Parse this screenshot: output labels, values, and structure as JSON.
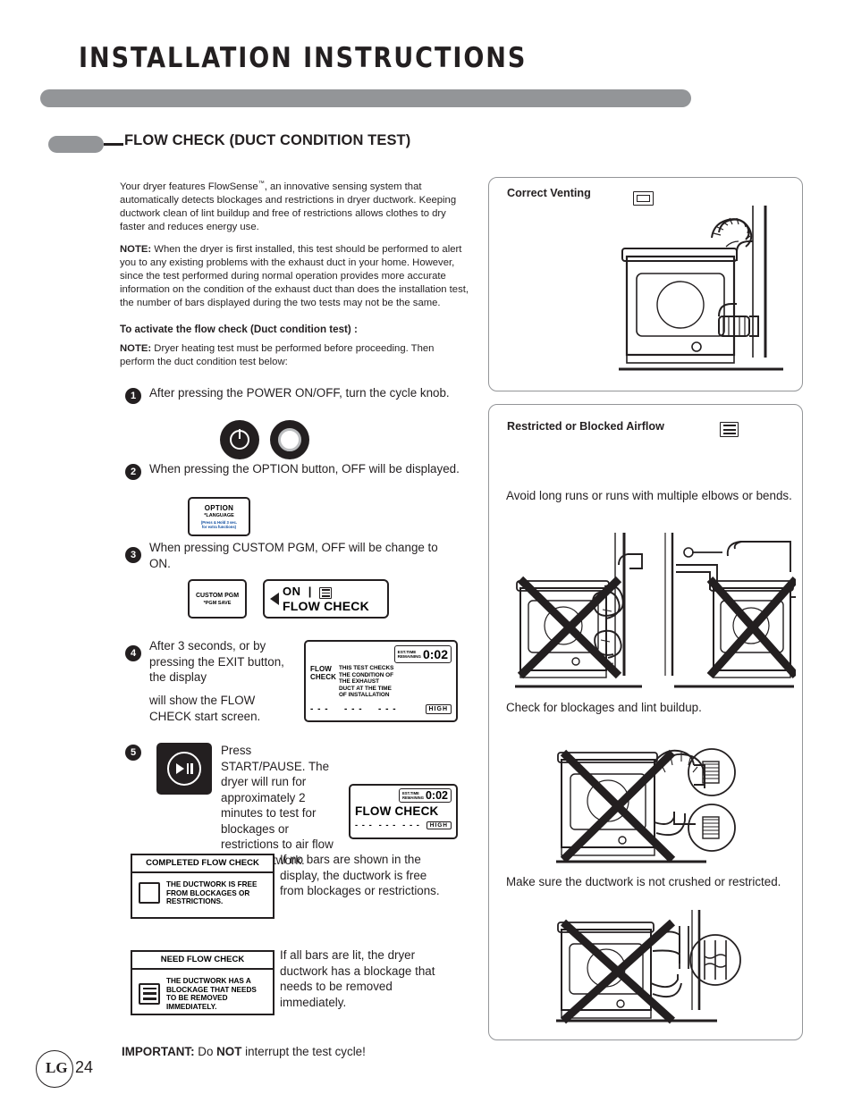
{
  "header": {
    "title": "INSTALLATION INSTRUCTIONS",
    "section_title": "FLOW CHECK (DUCT CONDITION TEST)"
  },
  "intro": {
    "p1_a": "Your dryer features FlowSense",
    "p1_sup": "™",
    "p1_b": ", an innovative sensing system that automatically detects blockages and restrictions in dryer ductwork. Keeping ductwork clean of lint buildup and free of restrictions allows clothes to dry faster and reduces energy use.",
    "note1_label": "NOTE:",
    "note1_text": " When the dryer is first installed, this test should be performed to alert you to any existing problems with the exhaust duct in your home.  However, since the test performed during normal operation provides more accurate information on the condition of the exhaust duct than does the installation test, the number of bars displayed during the two tests may not be the same.",
    "subhead": "To activate the flow check (Duct condition test) :",
    "note2_label": "NOTE:",
    "note2_text": " Dryer heating test must be performed before proceeding. Then perform the duct condition test below:"
  },
  "steps": [
    {
      "num": "1",
      "text": "After pressing the POWER ON/OFF, turn the cycle knob."
    },
    {
      "num": "2",
      "text": "When pressing the OPTION button, OFF will be displayed."
    },
    {
      "num": "3",
      "text": "When pressing CUSTOM PGM, OFF will be change to ON."
    },
    {
      "num": "4",
      "text": "After 3 seconds, or by pressing the EXIT button, the display",
      "text2": "will show the FLOW CHECK start screen."
    },
    {
      "num": "5",
      "text": "Press START/PAUSE. The dryer will run for approximately 2 minutes to test for blockages or restrictions to air flow in the ductwork."
    }
  ],
  "controls": {
    "option_label": "OPTION",
    "option_sub": "*LANGUAGE",
    "option_note": "(Press & Hold 3 sec.\nfor extra functions)",
    "custom_label": "CUSTOM PGM",
    "custom_sub": "*PGM SAVE",
    "on_label": "ON",
    "flow_check_label": "FLOW CHECK",
    "bar_icon": "bars-icon"
  },
  "lcd_start": {
    "title": "FLOW CHECK",
    "description": "THIS TEST CHECKS THE CONDITION OF THE EXHAUST DUCT AT THE TIME OF INSTALLATION",
    "est_label_1": "EST.TIME",
    "est_label_2": "REMAINING",
    "est_value": "0:02",
    "dash": "- - -",
    "high": "HIGH"
  },
  "lcd_run": {
    "est_label_1": "EST.TIME",
    "est_label_2": "REMAINING",
    "est_value": "0:02",
    "title": "FLOW CHECK",
    "dash": "- - -",
    "high": "HIGH"
  },
  "results": {
    "completed_header": "COMPLETED FLOW CHECK",
    "completed_body": "THE DUCTWORK IS FREE FROM BLOCKAGES OR RESTRICTIONS.",
    "need_header": "NEED FLOW CHECK",
    "need_body": "THE DUCTWORK HAS A BLOCKAGE THAT NEEDS TO BE REMOVED IMMEDIATELY.",
    "completed_text": "If no bars are shown in the display, the ductwork is free from blockages or restrictions.",
    "need_text": "If all bars are lit, the dryer ductwork has a blockage that needs to be removed immediately."
  },
  "important": {
    "label": "IMPORTANT:",
    "mid": " Do ",
    "not": "NOT",
    "end": " interrupt the test cycle!"
  },
  "right": {
    "panel1_title": "Correct Venting",
    "panel2_title": "Restricted or Blocked Airflow",
    "caption1": "Avoid long runs or runs with multiple elbows or bends.",
    "caption2": "Check for blockages and lint buildup.",
    "caption3": "Make sure the ductwork is not crushed or restricted."
  },
  "footer": {
    "brand": "LG",
    "page": "24"
  },
  "colors": {
    "ink": "#231f20",
    "gray": "#939598",
    "blue": "#0a4a9e"
  }
}
